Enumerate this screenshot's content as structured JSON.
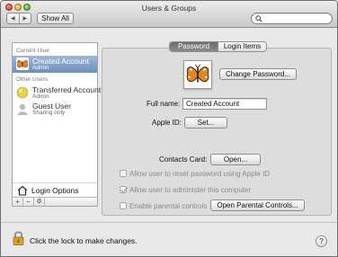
{
  "window": {
    "title": "Users & Groups"
  },
  "toolbar": {
    "back_icon": "back-arrow-icon",
    "forward_icon": "forward-arrow-icon",
    "show_all_label": "Show All",
    "search_value": ""
  },
  "sidebar": {
    "current_user_header": "Current User",
    "other_users_header": "Other Users",
    "current_user": {
      "name": "Created Account",
      "role": "Admin",
      "icon": "butterfly-avatar-icon"
    },
    "other_users": [
      {
        "name": "Transferred Account",
        "role": "Admin",
        "icon": "yellow-ball-avatar-icon"
      },
      {
        "name": "Guest User",
        "role": "Sharing only",
        "icon": "silhouette-avatar-icon"
      }
    ],
    "login_options_label": "Login Options",
    "add_label": "+",
    "remove_label": "−",
    "action_label": "⚙"
  },
  "tabs": {
    "password_label": "Password",
    "login_items_label": "Login Items",
    "active": "Password"
  },
  "main": {
    "change_password_label": "Change Password...",
    "full_name_label": "Full name:",
    "full_name_value": "Created Account",
    "apple_id_label": "Apple ID:",
    "apple_id_set_label": "Set...",
    "contacts_card_label": "Contacts Card:",
    "contacts_open_label": "Open...",
    "reset_password_label": "Allow user to reset password using Apple ID",
    "administer_label": "Allow user to administer this computer",
    "parental_label": "Enable parental controls",
    "open_parental_label": "Open Parental Controls...",
    "reset_password_checked": false,
    "administer_checked": true,
    "parental_checked": false
  },
  "footer": {
    "lock_text": "Click the lock to make changes.",
    "help_label": "?"
  },
  "colors": {
    "selection": "#7f9bc6",
    "panel": "#dddddd",
    "window": "#e8e8e8"
  }
}
